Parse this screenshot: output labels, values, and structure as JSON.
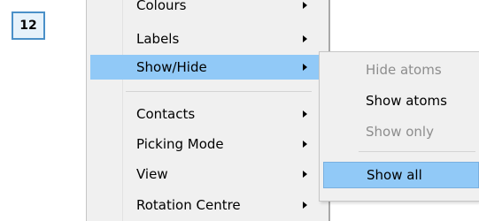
{
  "step": {
    "number": "12"
  },
  "main_menu": {
    "items": [
      {
        "label": "Colours",
        "submenu": true,
        "state": "normal"
      },
      {
        "label": "Labels",
        "submenu": true,
        "state": "normal"
      },
      {
        "label": "Show/Hide",
        "submenu": true,
        "state": "highlighted"
      },
      {
        "label": "Contacts",
        "submenu": true,
        "state": "normal"
      },
      {
        "label": "Picking Mode",
        "submenu": true,
        "state": "normal"
      },
      {
        "label": "View",
        "submenu": true,
        "state": "normal"
      },
      {
        "label": "Rotation Centre",
        "submenu": true,
        "state": "normal"
      }
    ]
  },
  "submenu": {
    "items": [
      {
        "label": "Hide atoms",
        "state": "disabled"
      },
      {
        "label": "Show atoms",
        "state": "enabled"
      },
      {
        "label": "Show only",
        "state": "disabled"
      },
      {
        "label": "Show all",
        "state": "highlighted"
      }
    ]
  },
  "colors": {
    "highlight": "#91c9f7",
    "menu_background": "#f0f0f0",
    "disabled_text": "#8d8d8d",
    "badge_border": "#4a90c8"
  }
}
